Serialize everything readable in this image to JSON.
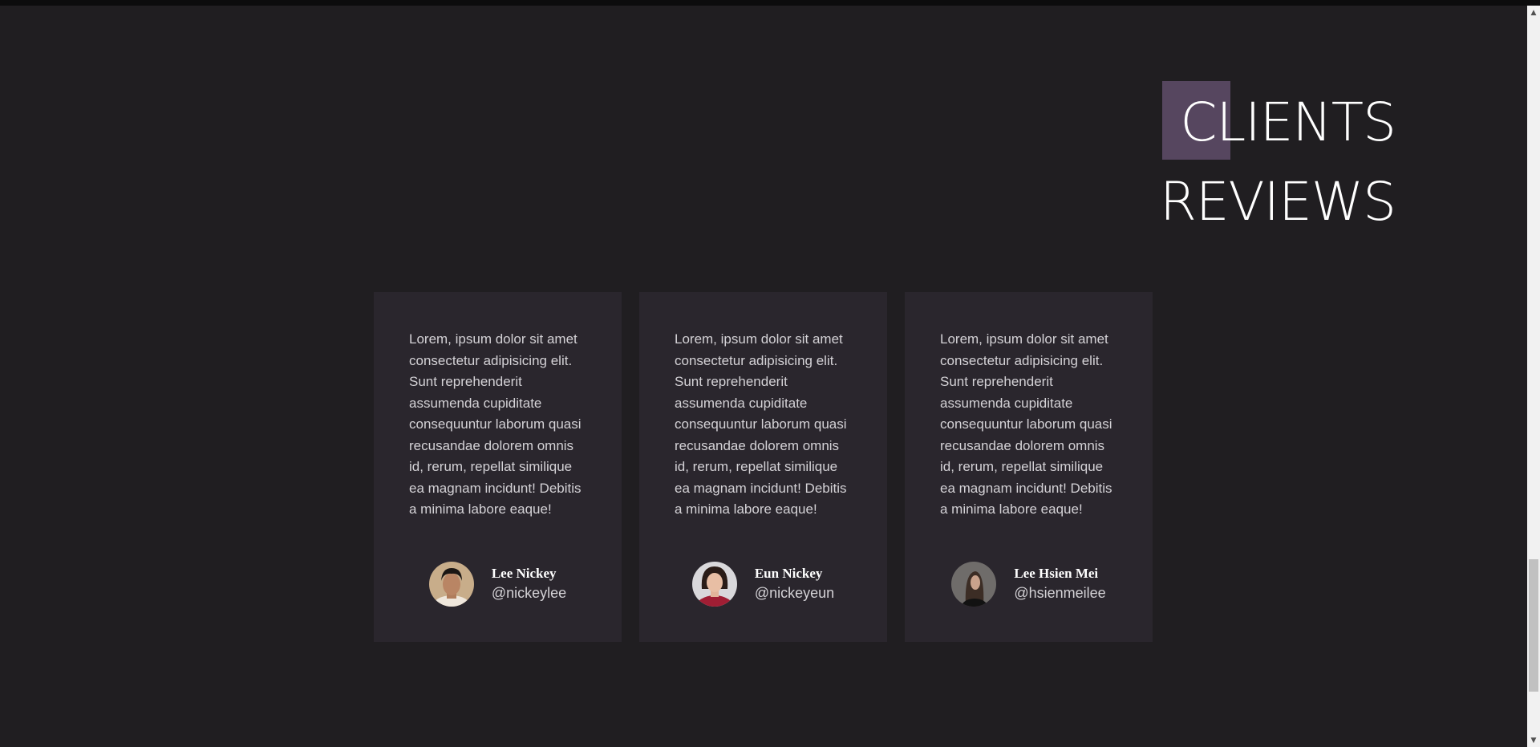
{
  "section": {
    "title_line1": "CLIENTS",
    "title_line2": "REVIEWS",
    "accent_color": "#56465f"
  },
  "reviews": [
    {
      "text": "Lorem, ipsum dolor sit amet consectetur adipisicing elit. Sunt reprehenderit assumenda cupiditate consequuntur laborum quasi recusandae dolorem omnis id, rerum, repellat similique ea magnam incidunt! Debitis a minima labore eaque!",
      "name": "Lee Nickey",
      "handle": "@nickeylee"
    },
    {
      "text": "Lorem, ipsum dolor sit amet consectetur adipisicing elit. Sunt reprehenderit assumenda cupiditate consequuntur laborum quasi recusandae dolorem omnis id, rerum, repellat similique ea magnam incidunt! Debitis a minima labore eaque!",
      "name": "Eun Nickey",
      "handle": "@nickeyeun"
    },
    {
      "text": "Lorem, ipsum dolor sit amet consectetur adipisicing elit. Sunt reprehenderit assumenda cupiditate consequuntur laborum quasi recusandae dolorem omnis id, rerum, repellat similique ea magnam incidunt! Debitis a minima labore eaque!",
      "name": "Lee Hsien Mei",
      "handle": "@hsienmeilee"
    }
  ],
  "colors": {
    "background": "#201e21",
    "card": "#2a262d",
    "text": "#d4d2d6"
  },
  "scrollbar": {
    "up_icon": "scroll-up-arrow-icon",
    "down_icon": "scroll-down-arrow-icon"
  }
}
